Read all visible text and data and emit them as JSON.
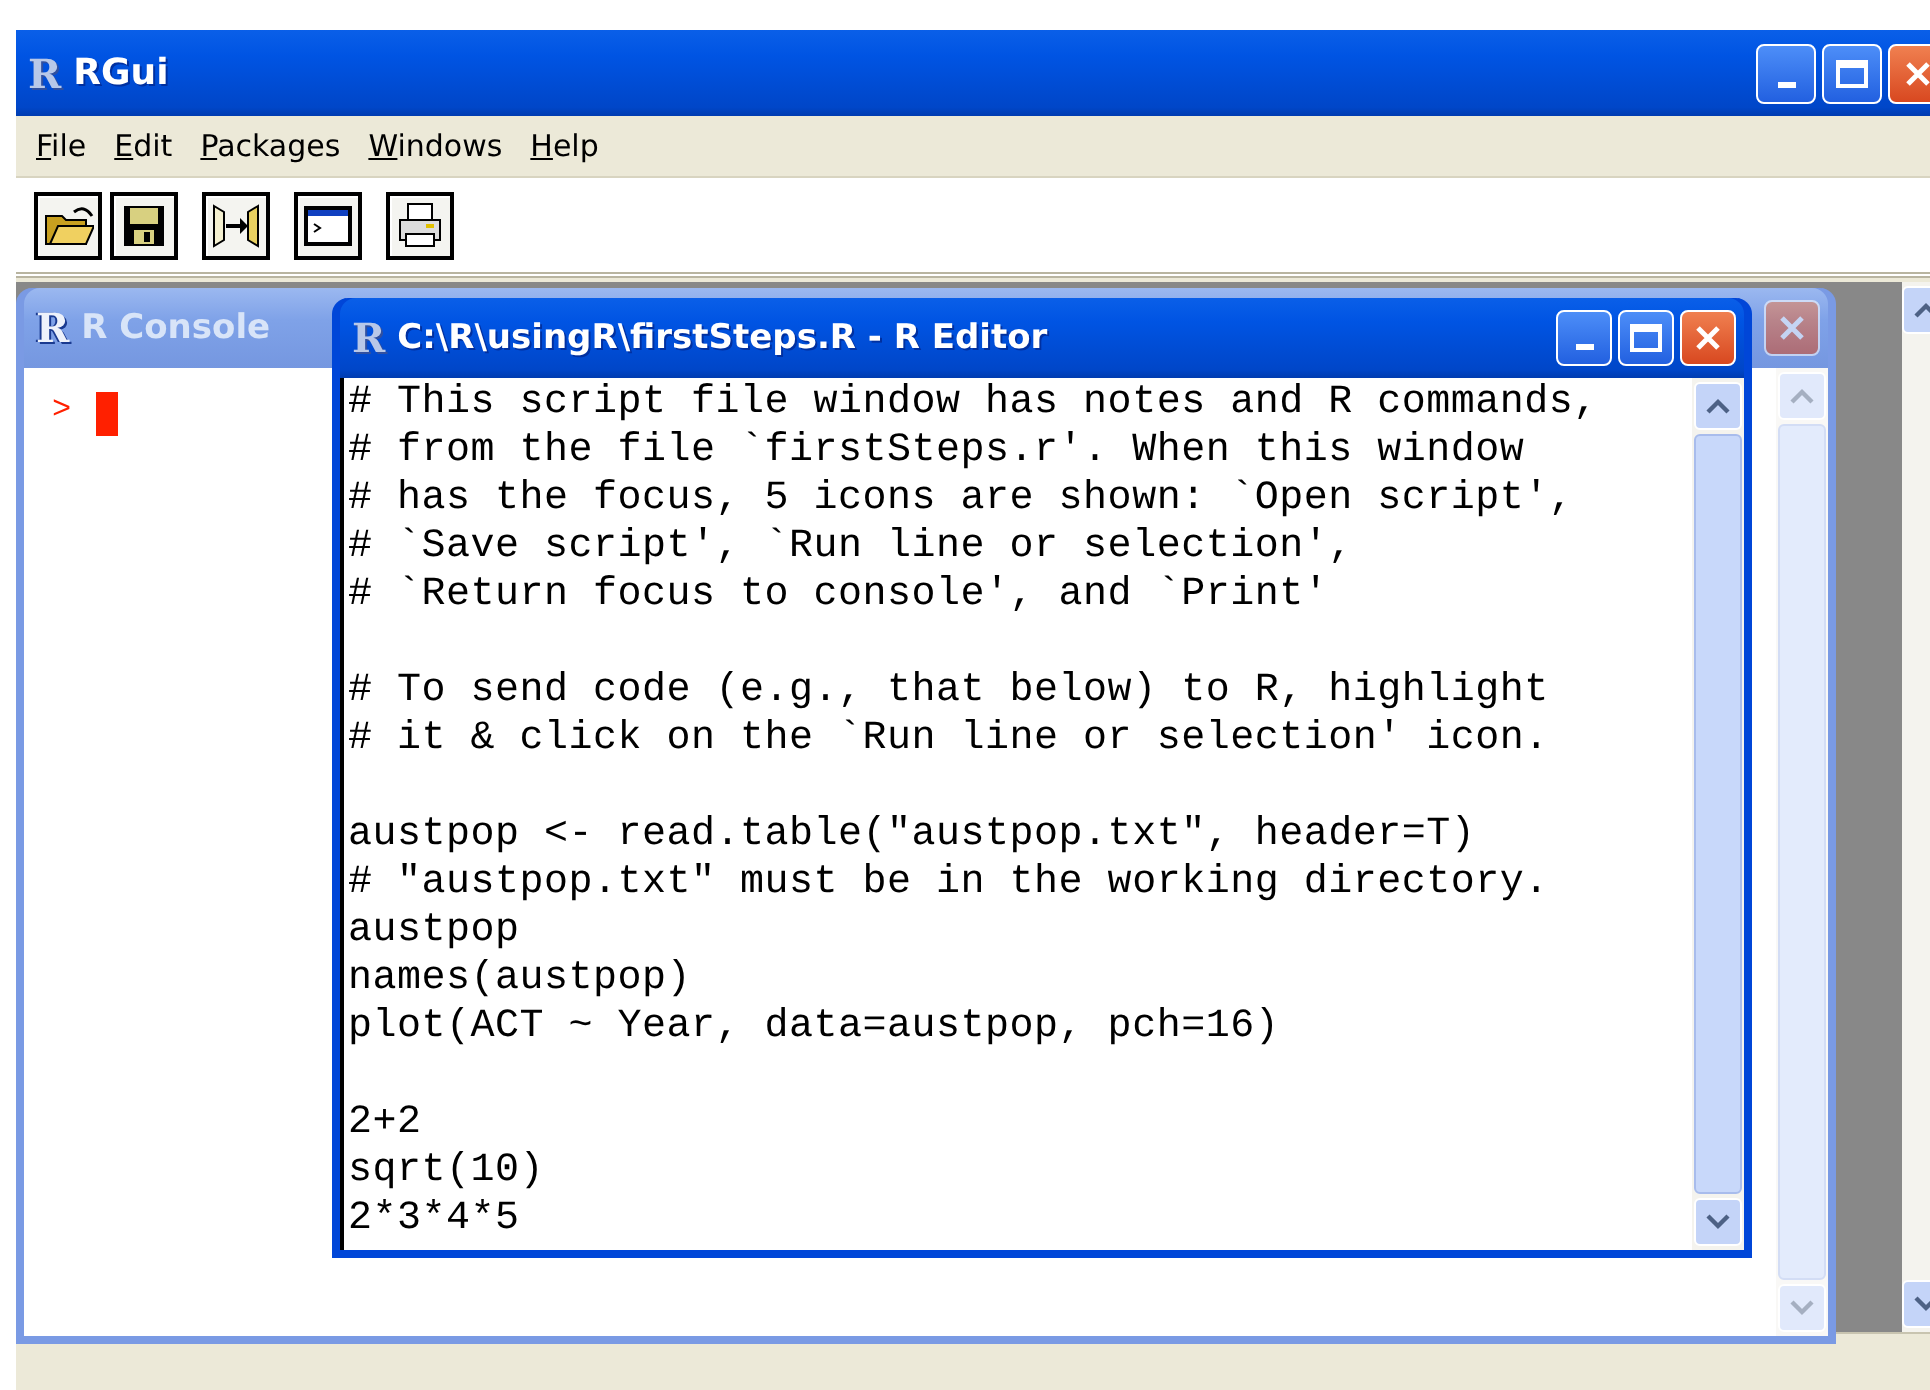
{
  "app": {
    "logo": "R",
    "title": "RGui",
    "active": true
  },
  "menu": [
    {
      "label": "File"
    },
    {
      "label": "Edit"
    },
    {
      "label": "Packages"
    },
    {
      "label": "Windows"
    },
    {
      "label": "Help"
    }
  ],
  "toolbar": [
    {
      "kind": "open"
    },
    {
      "kind": "save"
    },
    {
      "kind": "run"
    },
    {
      "kind": "console"
    },
    {
      "kind": "print"
    }
  ],
  "console": {
    "logo": "R",
    "title": "R Console",
    "active": false,
    "prompt": ">"
  },
  "editor": {
    "logo": "R",
    "title": "C:\\R\\usingR\\firstSteps.R - R Editor",
    "active": true,
    "blocks": [
      [
        "# This script file window has notes and R commands,",
        "# from the file `firstSteps.r'. When this window",
        "# has the focus, 5 icons are shown: `Open script',",
        "# `Save script', `Run line or selection',",
        "# `Return focus to console', and `Print'"
      ],
      [
        "# To send code (e.g., that below) to R, highlight",
        "# it & click on the `Run line or selection' icon."
      ],
      [
        "austpop <- read.table(\"austpop.txt\", header=T)",
        "# \"austpop.txt\" must be in the working directory.",
        "austpop",
        "names(austpop)",
        "plot(ACT ~ Year, data=austpop, pch=16)"
      ],
      [
        "2+2",
        "sqrt(10)",
        "2*3*4*5"
      ]
    ]
  }
}
